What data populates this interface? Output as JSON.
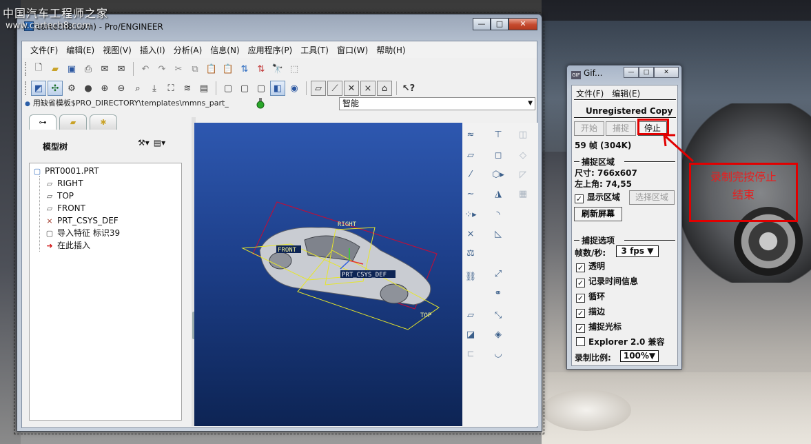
{
  "watermark": {
    "site_name": "中国汽车工程师之家",
    "url": "www.cartech8.com"
  },
  "proe": {
    "title": "cartech8.com) - Pro/ENGINEER",
    "menu": [
      "文件(F)",
      "编辑(E)",
      "视图(V)",
      "插入(I)",
      "分析(A)",
      "信息(N)",
      "应用程序(P)",
      "工具(T)",
      "窗口(W)",
      "帮助(H)"
    ],
    "path_text": "用缺省模板$PRO_DIRECTORY\\templates\\mmns_part_",
    "filter_value": "智能",
    "tree_title": "模型树",
    "tree_items": [
      {
        "label": "PRT0001.PRT",
        "icon": "part-icon"
      },
      {
        "label": "RIGHT",
        "icon": "datum-plane-icon"
      },
      {
        "label": "TOP",
        "icon": "datum-plane-icon"
      },
      {
        "label": "FRONT",
        "icon": "datum-plane-icon"
      },
      {
        "label": "PRT_CSYS_DEF",
        "icon": "csys-icon"
      },
      {
        "label": "导入特征 标识39",
        "icon": "import-feature-icon"
      },
      {
        "label": "在此插入",
        "icon": "insert-here-arrow-icon"
      }
    ],
    "datum_labels": {
      "right": "RIGHT",
      "front": "FRONT",
      "top": "TOP",
      "csys": "PRT_CSYS_DEF"
    },
    "colors": {
      "graphics_top": "#2e58b0",
      "graphics_bottom": "#0d2454",
      "datum": "#e6e62a",
      "box": "#b3123f"
    }
  },
  "gif": {
    "title": "Gif...",
    "menu": [
      "文件(F)",
      "编辑(E)"
    ],
    "unregistered": "Unregistered Copy",
    "btn_start": "开始",
    "btn_capture": "捕捉",
    "btn_stop": "停止",
    "frames": "59 帧 (304K)",
    "section_area": "捕捉区域",
    "size": "尺寸: 766x607",
    "top_left": "左上角: 74,55",
    "show_area": "显示区域",
    "btn_select_area": "选择区域",
    "btn_refresh": "刷新屏幕",
    "section_options": "捕捉选项",
    "fps_label": "帧数/秒:",
    "fps_value": "3 fps",
    "options": [
      {
        "label": "透明",
        "checked": true
      },
      {
        "label": "记录时间信息",
        "checked": true
      },
      {
        "label": "循环",
        "checked": true
      },
      {
        "label": "描边",
        "checked": true
      },
      {
        "label": "捕捉光标",
        "checked": true
      },
      {
        "label": "Explorer 2.0 兼容",
        "checked": false
      }
    ],
    "scale_label": "录制比例:",
    "scale_value": "100%"
  },
  "annotation": {
    "line1": "录制完按停止",
    "line2": "结束",
    "color": "#e10000"
  }
}
